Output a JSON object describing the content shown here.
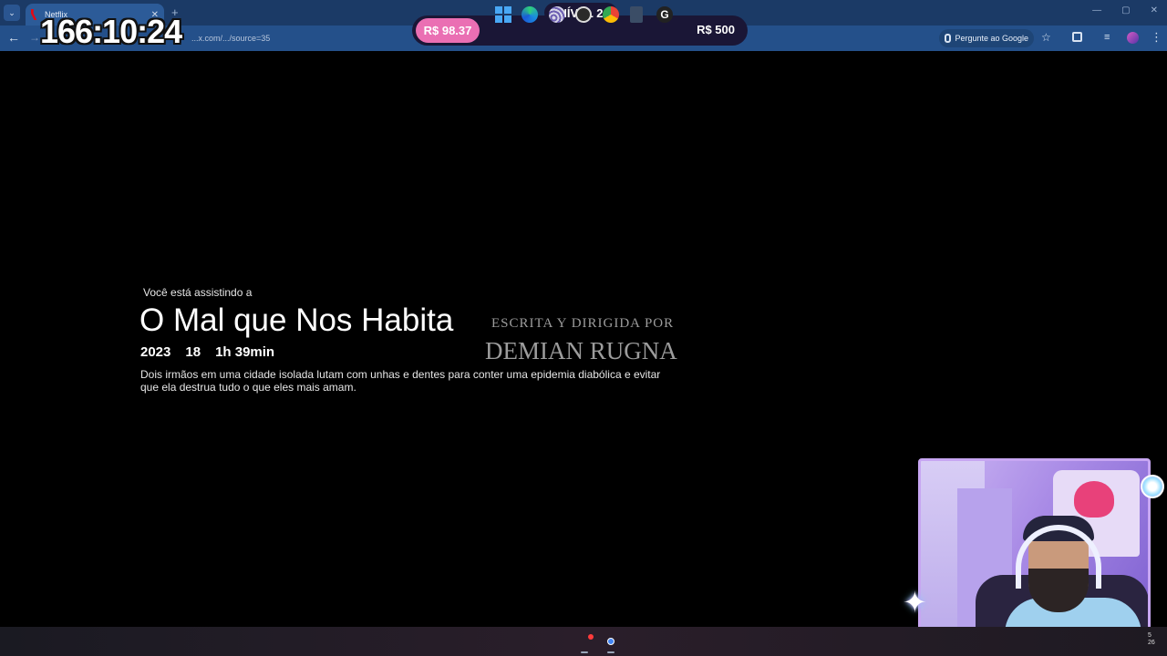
{
  "browser": {
    "tab_title": "Netflix",
    "tab_close": "✕",
    "new_tab": "+",
    "url_fragment": "...x.com/.../source=35",
    "google_button": "Pergunte ao Google",
    "window_controls": [
      "—",
      "▢",
      "✕"
    ]
  },
  "overlay": {
    "timer": "166:10:24",
    "level": "NÍVEL 2",
    "goal_current": "R$ 98.37",
    "goal_target": "R$ 500"
  },
  "player": {
    "watching_label": "Você está assistindo a",
    "title": "O Mal que Nos Habita",
    "year": "2023",
    "rating": "18",
    "duration": "1h 39min",
    "synopsis": "Dois irmãos em uma cidade isolada lutam com unhas e dentes para conter uma epidemia diabólica e evitar que ela destrua tudo o que eles mais amam.",
    "credit_line_1": "ESCRITA Y DIRIGIDA POR",
    "credit_line_2": "DEMIAN RUGNA"
  },
  "taskbar": {
    "apps": [
      "windows-start",
      "edge",
      "shell",
      "obs",
      "chrome",
      "calculator",
      "g-hub"
    ],
    "tray_time": "5",
    "tray_date": "26"
  },
  "colors": {
    "tabbar": "#1b3a66",
    "toolbar": "#24508a",
    "goal_pink": "#ea6fb3",
    "goal_bg": "#1a1636",
    "webcam_border": "#c7a6f2"
  }
}
